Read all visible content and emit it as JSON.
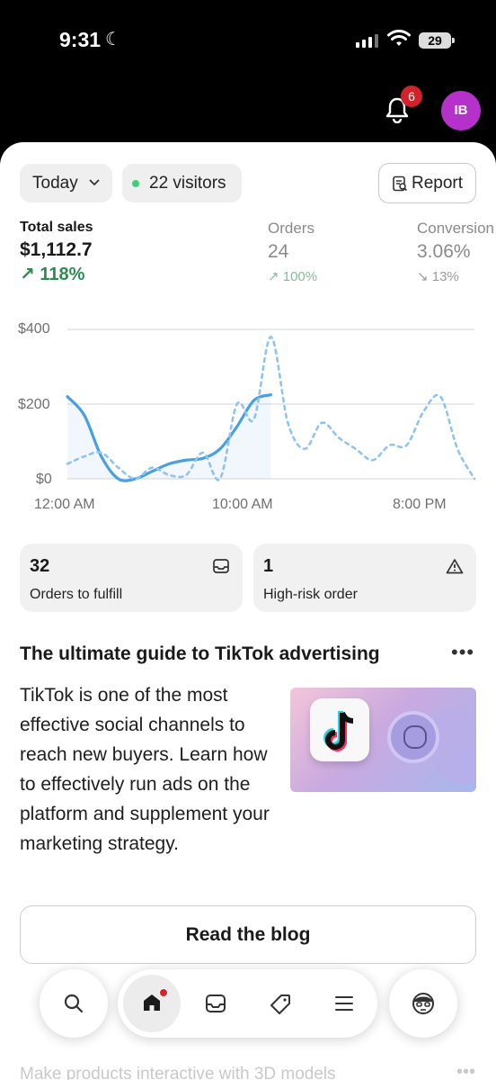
{
  "status": {
    "time": "9:31",
    "battery": "29"
  },
  "header": {
    "notification_count": "6",
    "avatar_initials": "IB"
  },
  "filters": {
    "period": "Today",
    "visitors": "22 visitors",
    "report_label": "Report"
  },
  "metrics": [
    {
      "label": "Total sales",
      "value": "$1,112.7",
      "change": "118%"
    },
    {
      "label": "Orders",
      "value": "24",
      "change": "100%"
    },
    {
      "label": "Conversion",
      "value": "3.06%",
      "change": "13%"
    }
  ],
  "chart_data": {
    "type": "line",
    "y_ticks": [
      "$400",
      "$200",
      "$0"
    ],
    "x_ticks": [
      "12:00 AM",
      "10:00 AM",
      "8:00 PM"
    ],
    "ylim": [
      0,
      400
    ],
    "x_count": 24,
    "series": [
      {
        "style": "solid",
        "values": [
          220,
          170,
          60,
          0,
          0,
          20,
          40,
          50,
          55,
          80,
          140,
          210,
          225,
          null,
          null,
          null,
          null,
          null,
          null,
          null,
          null,
          null,
          null,
          null
        ]
      },
      {
        "style": "dashed",
        "values": [
          40,
          60,
          70,
          30,
          0,
          30,
          10,
          10,
          70,
          0,
          200,
          160,
          380,
          150,
          80,
          150,
          110,
          80,
          50,
          90,
          90,
          180,
          220,
          80,
          0
        ]
      }
    ]
  },
  "cards": [
    {
      "count": "32",
      "label": "Orders to fulfill"
    },
    {
      "count": "1",
      "label": "High-risk order"
    }
  ],
  "guide": {
    "title": "The ultimate guide to TikTok advertising",
    "body": "TikTok is one of the most effective social channels to reach new buyers. Learn how to effectively run ads on the platform and supplement your marketing strategy.",
    "cta": "Read the blog"
  },
  "next_card": {
    "title": "Make products interactive with 3D models"
  },
  "colors": {
    "accent": "#4a9fe0",
    "positive": "#2f8a50",
    "badge": "#d0232b",
    "avatar": "#b432c9"
  }
}
